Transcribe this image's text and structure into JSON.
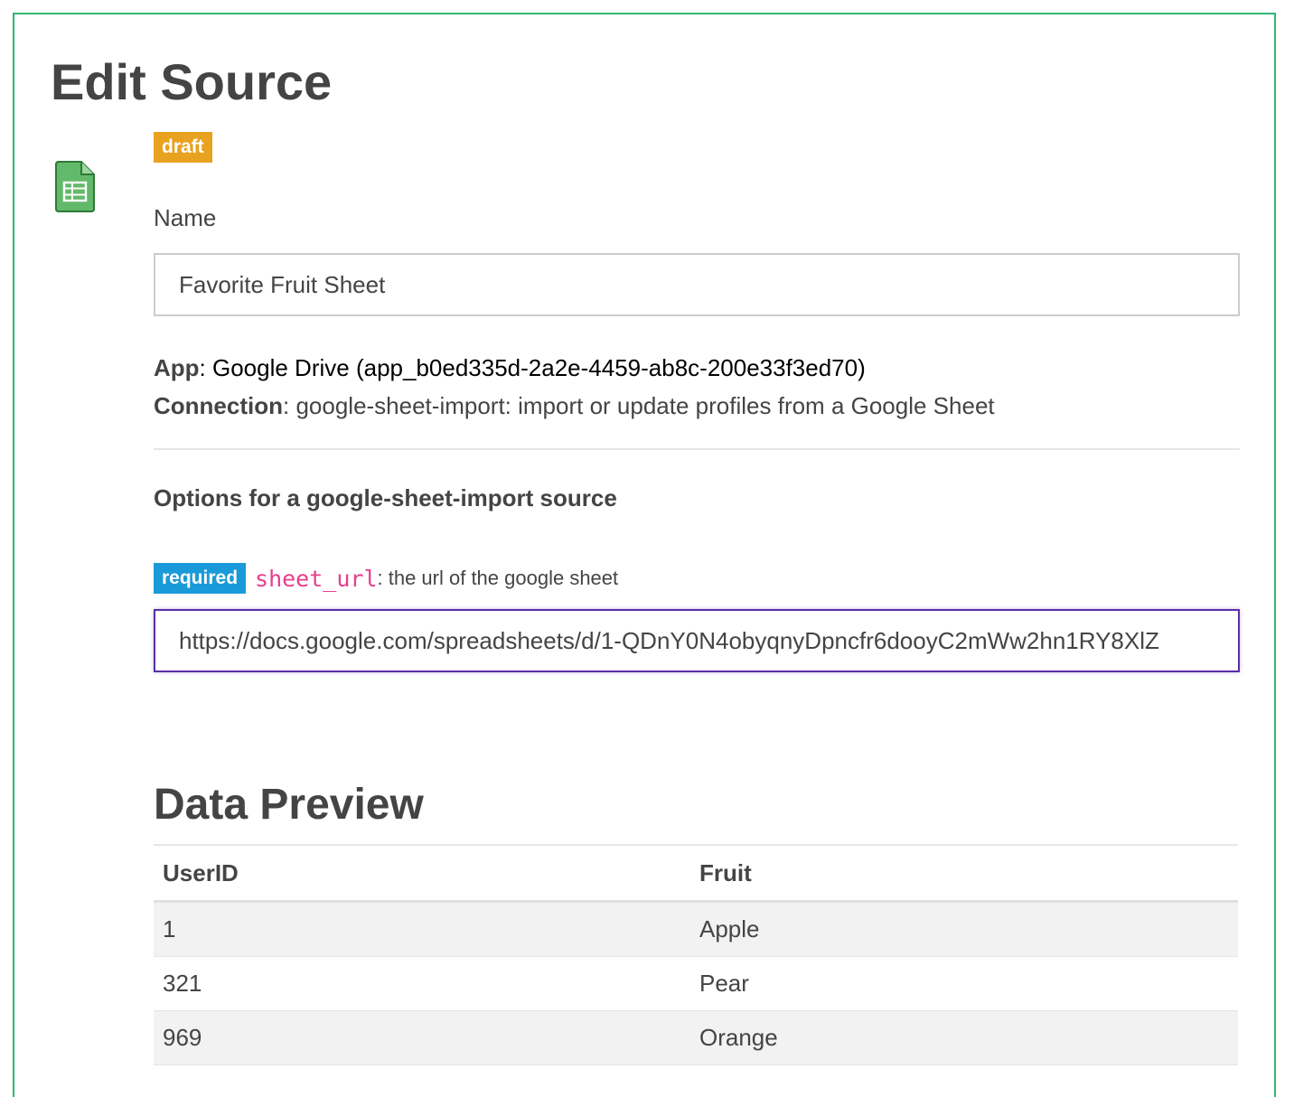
{
  "page": {
    "title": "Edit Source"
  },
  "source": {
    "icon": "google-sheets-icon",
    "status_badge": "draft",
    "name_label": "Name",
    "name_value": "Favorite Fruit Sheet",
    "app_label": "App",
    "app_value": ": Google Drive (app_b0ed335d-2a2e-4459-ab8c-200e33f3ed70)",
    "connection_label": "Connection",
    "connection_value": ": google-sheet-import: import or update profiles from a Google Sheet"
  },
  "options": {
    "heading": "Options for a google-sheet-import source",
    "items": [
      {
        "required_badge": "required",
        "key": "sheet_url",
        "description": ": the url of the google sheet",
        "value": "https://docs.google.com/spreadsheets/d/1-QDnY0N4obyqnyDpncfr6dooyC2mWw2hn1RY8XlZ"
      }
    ]
  },
  "preview": {
    "title": "Data Preview",
    "columns": [
      "UserID",
      "Fruit"
    ],
    "rows": [
      [
        "1",
        "Apple"
      ],
      [
        "321",
        "Pear"
      ],
      [
        "969",
        "Orange"
      ]
    ]
  },
  "colors": {
    "frame_border": "#2eb872",
    "draft_badge": "#e9a21f",
    "required_badge": "#1a9ad9",
    "option_key": "#e83e8c",
    "focused_input_border": "#5a2ea6"
  }
}
